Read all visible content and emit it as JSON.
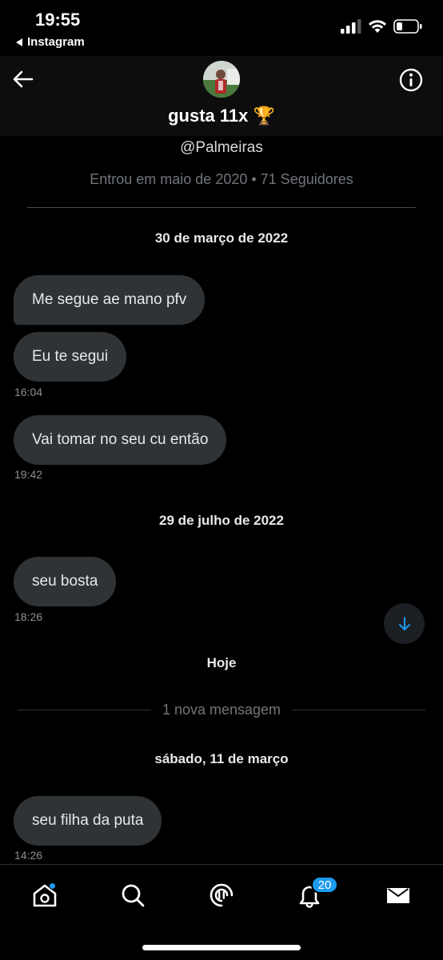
{
  "status_bar": {
    "time": "19:55",
    "back_app": "Instagram",
    "icons": [
      "cellular-signal-icon",
      "wifi-icon",
      "battery-icon"
    ]
  },
  "header": {
    "name": "gusta 11x",
    "emoji": "🏆",
    "back_icon": "back-arrow-icon",
    "info_icon": "info-icon"
  },
  "profile": {
    "handle": "@Palmeiras",
    "meta": "Entrou em maio de 2020 • 71 Seguidores"
  },
  "conversation": {
    "date1": "30 de março de 2022",
    "msg1": "Me segue ae mano pfv",
    "msg2": "Eu te segui",
    "time2": "16:04",
    "msg3": "Vai tomar no seu cu então",
    "time3": "19:42",
    "date2": "29 de julho de 2022",
    "msg4": "seu bosta",
    "time4": "18:26",
    "date3": "Hoje",
    "new_messages": "1 nova mensagem",
    "date4": "sábado, 11 de março",
    "msg5": "seu filha da puta",
    "time5": "14:26"
  },
  "tabbar": {
    "notifications_count": "20",
    "tabs": [
      "home-icon",
      "search-icon",
      "spaces-icon",
      "notifications-icon",
      "messages-icon"
    ]
  },
  "colors": {
    "background": "#000000",
    "bubble": "#2f3336",
    "accent": "#1d9bf0",
    "muted": "#71767b"
  }
}
